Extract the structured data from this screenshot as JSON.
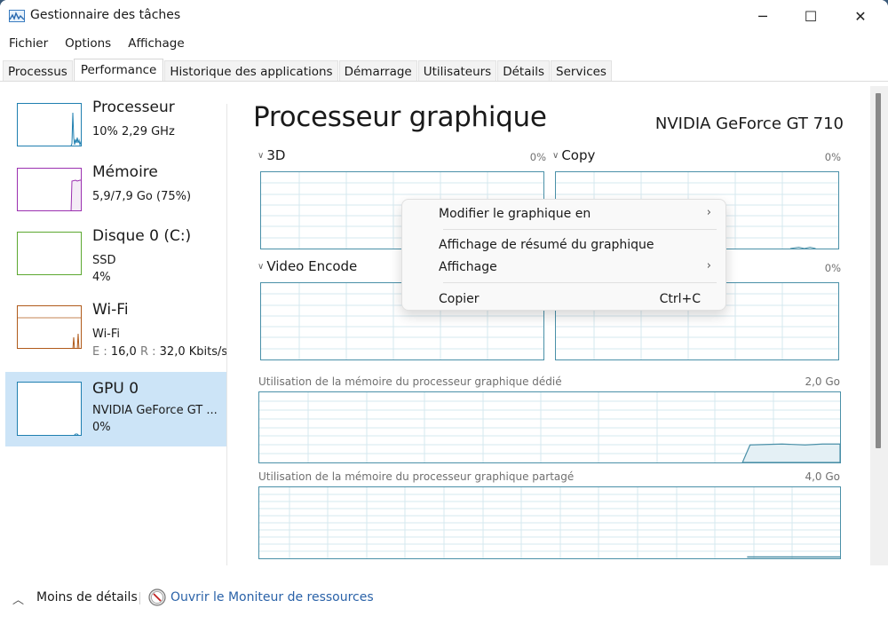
{
  "window": {
    "title": "Gestionnaire des tâches",
    "controls": {
      "minimize": "─",
      "maximize": "☐",
      "close": "✕"
    }
  },
  "menubar": [
    "Fichier",
    "Options",
    "Affichage"
  ],
  "tabs": [
    {
      "label": "Processus",
      "active": false
    },
    {
      "label": "Performance",
      "active": true
    },
    {
      "label": "Historique des applications",
      "active": false
    },
    {
      "label": "Démarrage",
      "active": false
    },
    {
      "label": "Utilisateurs",
      "active": false
    },
    {
      "label": "Détails",
      "active": false
    },
    {
      "label": "Services",
      "active": false
    }
  ],
  "sidebar": {
    "items": [
      {
        "title": "Processeur",
        "sub1": "10% 2,29 GHz",
        "color": "#1f7fb0",
        "selected": false
      },
      {
        "title": "Mémoire",
        "sub1": "5,9/7,9 Go (75%)",
        "color": "#9b30b0",
        "selected": false
      },
      {
        "title": "Disque 0 (C:)",
        "sub1": "SSD",
        "sub2": "4%",
        "color": "#5ca830",
        "selected": false
      },
      {
        "title": "Wi-Fi",
        "sub1": "Wi-Fi",
        "sub2_e_label": "E :",
        "sub2_e_value": "16,0",
        "sub2_r_label": "R :",
        "sub2_r_value": "32,0 Kbits/s",
        "color": "#b05a1a",
        "selected": false
      },
      {
        "title": "GPU 0",
        "sub1": "NVIDIA GeForce GT ...",
        "sub2": "0%",
        "color": "#1f7fb0",
        "selected": true
      }
    ]
  },
  "main": {
    "title": "Processeur graphique",
    "gpu_name": "NVIDIA GeForce GT 710",
    "panels": [
      {
        "label": "3D",
        "percent": "0%"
      },
      {
        "label": "Copy",
        "percent": "0%"
      },
      {
        "label": "Video Encode",
        "percent": ""
      },
      {
        "label": "",
        "percent": "0%"
      }
    ],
    "dedicated_memory": {
      "label": "Utilisation de la mémoire du processeur graphique dédié",
      "max": "2,0 Go"
    },
    "shared_memory": {
      "label": "Utilisation de la mémoire du processeur graphique partagé",
      "max": "4,0 Go"
    },
    "accent_color": "#4a90a8"
  },
  "context_menu": {
    "items": [
      {
        "label": "Modifier le graphique en",
        "submenu": "›"
      },
      {
        "label": "Affichage de résumé du graphique"
      },
      {
        "label": "Affichage",
        "submenu": "›"
      },
      {
        "label": "Copier",
        "shortcut": "Ctrl+C"
      }
    ]
  },
  "footer": {
    "less_details": "Moins de détails",
    "resource_monitor": "Ouvrir le Moniteur de ressources",
    "caret": "^"
  }
}
